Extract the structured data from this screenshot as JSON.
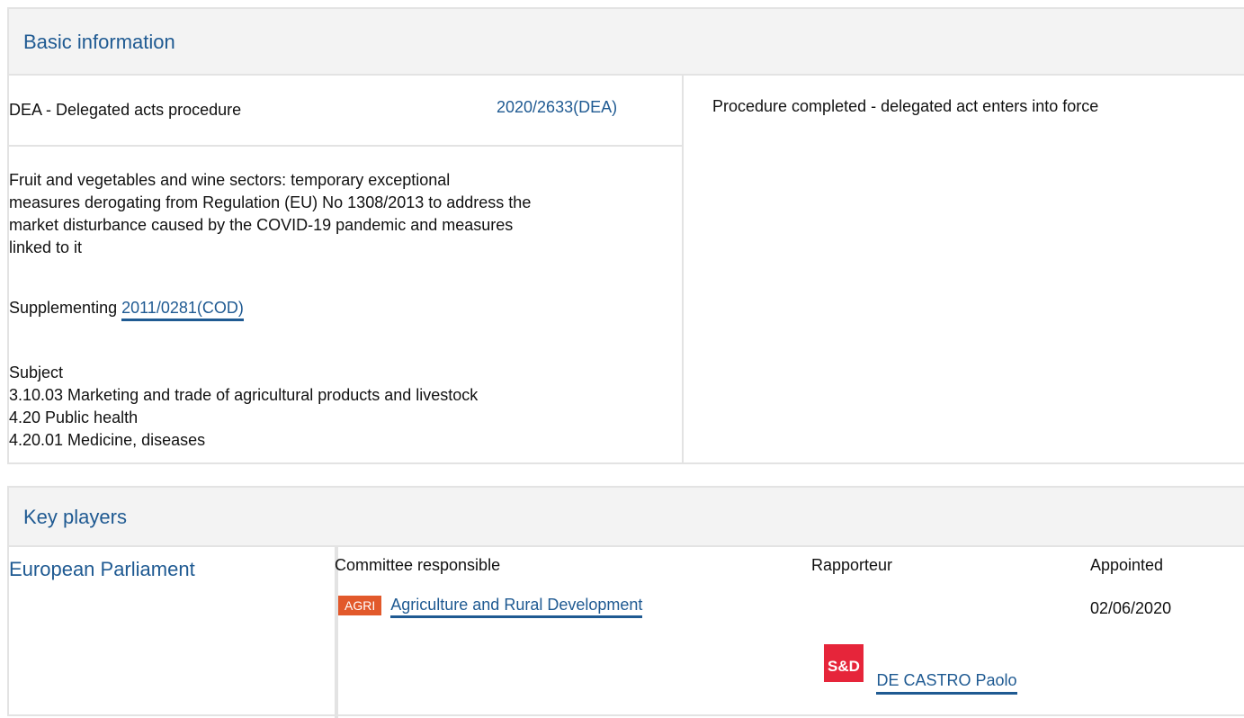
{
  "basic_information": {
    "title": "Basic information",
    "procedure_type": "DEA - Delegated acts procedure",
    "reference": "2020/2633(DEA)",
    "status": "Procedure completed - delegated act enters into force",
    "description_lines": [
      "Fruit and vegetables and wine sectors: temporary exceptional",
      "measures derogating from Regulation (EU) No 1308/2013 to address the",
      "market disturbance caused by the COVID-19 pandemic and measures",
      "linked to it"
    ],
    "supplementing_label": "Supplementing",
    "supplementing_ref": "2011/0281(COD)",
    "subject_label": "Subject",
    "subjects": [
      "3.10.03 Marketing and trade of agricultural products and livestock",
      "4.20 Public health",
      "4.20.01 Medicine, diseases"
    ]
  },
  "key_players": {
    "title": "Key players",
    "institution": "European Parliament",
    "headers": {
      "committee": "Committee responsible",
      "rapporteur": "Rapporteur",
      "appointed": "Appointed"
    },
    "committee": {
      "code": "AGRI",
      "name": "Agriculture and Rural Development",
      "appointed": "02/06/2020",
      "badge_color": "#e2592b"
    },
    "rapporteur": {
      "group_logo": "S&D",
      "group_color": "#e6253a",
      "name": "DE CASTRO Paolo"
    }
  },
  "colors": {
    "link": "#1f5a92",
    "header_bg": "#f3f3f3",
    "border": "#e3e3e3"
  }
}
